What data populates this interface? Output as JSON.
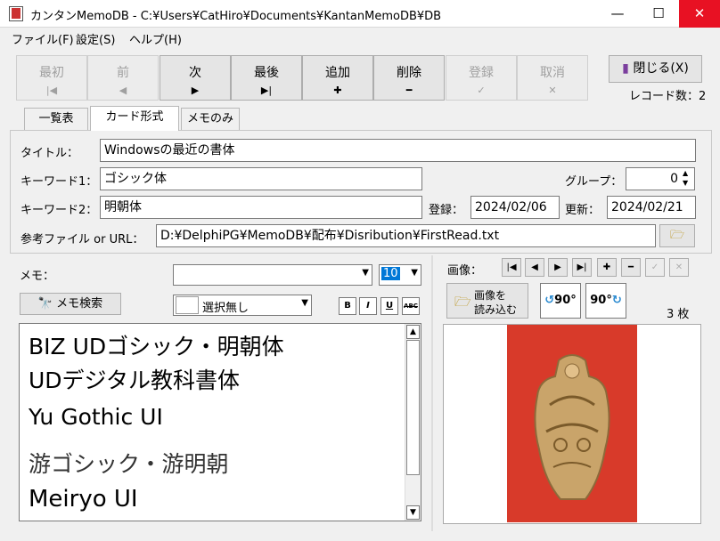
{
  "window": {
    "title": "カンタンMemoDB - C:¥Users¥CatHiro¥Documents¥KantanMemoDB¥DB",
    "minimize": "—",
    "maximize": "☐",
    "close": "✕"
  },
  "menu": [
    "ファイル(F)",
    "設定(S)",
    "ヘルプ(H)"
  ],
  "toolbar": {
    "buttons": [
      {
        "label": "最初",
        "icon": "|◀"
      },
      {
        "label": "前",
        "icon": "◀"
      },
      {
        "label": "次",
        "icon": "▶"
      },
      {
        "label": "最後",
        "icon": "▶|"
      },
      {
        "label": "追加",
        "icon": "✚"
      },
      {
        "label": "削除",
        "icon": "━"
      },
      {
        "label": "登録",
        "icon": "✓"
      },
      {
        "label": "取消",
        "icon": "✕"
      }
    ],
    "close_label": "閉じる(X)",
    "record_count": "レコード数：2"
  },
  "tabs": [
    "一覧表",
    "カード形式",
    "メモのみ"
  ],
  "card": {
    "title_label": "タイトル：",
    "title_value": "Windowsの最近の書体",
    "kw1_label": "キーワード1：",
    "kw1_value": "ゴシック体",
    "group_label": "グループ：",
    "group_value": "0",
    "kw2_label": "キーワード2：",
    "kw2_value": "明朝体",
    "reg_label": "登録：",
    "reg_value": "2024/02/06",
    "upd_label": "更新：",
    "upd_value": "2024/02/21",
    "file_label": "参考ファイル or URL：",
    "file_value": "D:¥DelphiPG¥MemoDB¥配布¥Disribution¥FirstRead.txt"
  },
  "memo": {
    "label": "メモ：",
    "font_size": "10",
    "search_label": "メモ検索",
    "color_select": "選択無し",
    "fmt": [
      "B",
      "I",
      "U",
      "ABC"
    ],
    "lines": [
      "BIZ UDゴシック・明朝体",
      "UDデジタル教科書体",
      "Yu Gothic UI",
      "游ゴシック・游明朝",
      "Meiryo UI"
    ]
  },
  "image": {
    "label": "画像：",
    "nav": [
      "|◀",
      "◀",
      "▶",
      "▶|",
      "✚",
      "━",
      "✓",
      "✕"
    ],
    "load_label_1": "画像を",
    "load_label_2": "読み込む",
    "rotate_left": "90°",
    "rotate_right": "90°",
    "count": "3 枚"
  },
  "colors": {
    "accent": "#0078d7",
    "close_red": "#e81123",
    "photo_bg": "#d83a2a"
  }
}
